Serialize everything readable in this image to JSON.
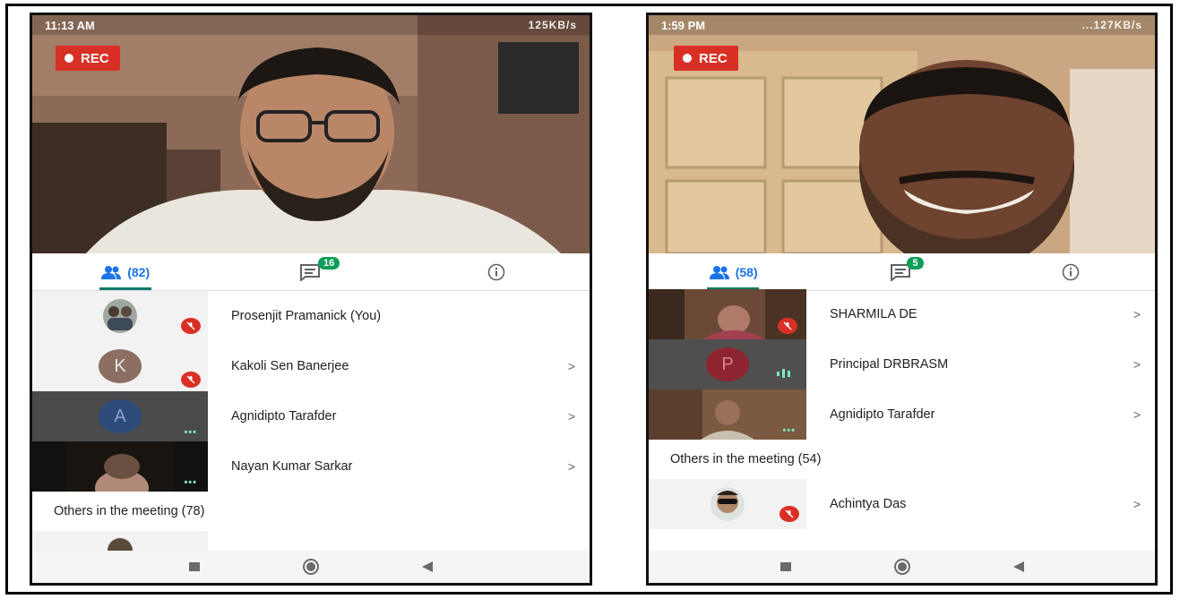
{
  "left": {
    "status": {
      "time": "11:13 AM",
      "right": "125KB/s"
    },
    "rec_label": "REC",
    "tabs": {
      "people_count": "(82)",
      "chat_badge": "16"
    },
    "participants": [
      {
        "name": "Prosenjit Pramanick (You)",
        "muted": true
      },
      {
        "name": "Kakoli Sen Banerjee",
        "avatar_letter": "K",
        "muted": true
      },
      {
        "name": "Agnidipto Tarafder",
        "avatar_letter": "A"
      },
      {
        "name": "Nayan Kumar Sarkar"
      }
    ],
    "others_heading": "Others in the meeting (78)"
  },
  "right": {
    "status": {
      "time": "1:59 PM",
      "right": "...127KB/s"
    },
    "rec_label": "REC",
    "tabs": {
      "people_count": "(58)",
      "chat_badge": "5"
    },
    "participants": [
      {
        "name": "SHARMILA DE",
        "muted": true
      },
      {
        "name": "Principal DRBRASM",
        "avatar_letter": "P",
        "speaking": true
      },
      {
        "name": "Agnidipto Tarafder"
      }
    ],
    "others_heading": "Others in the meeting (54)",
    "others": [
      {
        "name": "Achintya Das",
        "muted": true
      }
    ]
  },
  "chevron": ">",
  "colors": {
    "accent": "#1a73e8",
    "rec_red": "#d93025",
    "badge_green": "#0f9d58",
    "active_tab_underline": "#00796b"
  },
  "icons": [
    "people-icon",
    "chat-icon",
    "info-icon",
    "mic-off-icon",
    "chevron-right-icon",
    "nav-recents-icon",
    "nav-home-icon",
    "nav-back-icon"
  ]
}
